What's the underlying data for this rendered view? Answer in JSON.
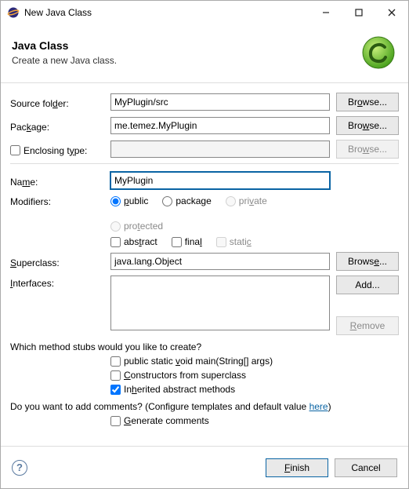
{
  "titlebar": {
    "title": "New Java Class"
  },
  "header": {
    "title": "Java Class",
    "desc": "Create a new Java class."
  },
  "labels": {
    "source_folder": "Source folder:",
    "package": "Package:",
    "enclosing_type": "Enclosing type:",
    "name": "Name:",
    "modifiers": "Modifiers:",
    "superclass": "Superclass:",
    "interfaces": "Interfaces:"
  },
  "fields": {
    "source_folder": "MyPlugin/src",
    "package": "me.temez.MyPlugin",
    "enclosing_type": "",
    "name": "MyPlugin",
    "superclass": "java.lang.Object"
  },
  "buttons": {
    "browse": "Browse...",
    "add": "Add...",
    "remove": "Remove",
    "finish": "Finish",
    "cancel": "Cancel"
  },
  "modifiers": {
    "public": "public",
    "package": "package",
    "private": "private",
    "protected": "protected",
    "abstract": "abstract",
    "final": "final",
    "static": "static",
    "selected_visibility": "public",
    "abstract_checked": false,
    "final_checked": false,
    "static_checked": false
  },
  "stubs": {
    "question": "Which method stubs would you like to create?",
    "main": "public static void main(String[] args)",
    "constructors": "Constructors from superclass",
    "inherited": "Inherited abstract methods",
    "main_checked": false,
    "constructors_checked": false,
    "inherited_checked": true
  },
  "comments": {
    "question_prefix": "Do you want to add comments? (Configure templates and default value ",
    "here": "here",
    "question_suffix": ")",
    "generate": "Generate comments",
    "generate_checked": false
  },
  "enclosing_checked": false
}
